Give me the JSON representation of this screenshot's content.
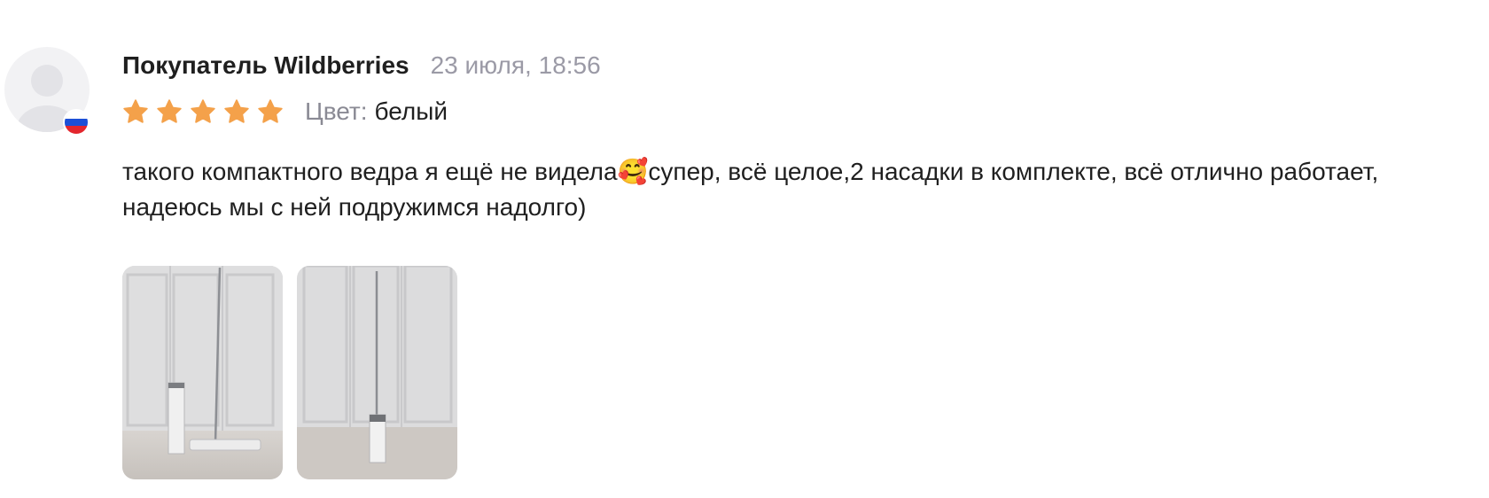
{
  "review": {
    "author": "Покупатель Wildberries",
    "date": "23 июля, 18:56",
    "rating": 5,
    "rating_max": 5,
    "star_color": "#f4a14a",
    "color_label": "Цвет:",
    "color_value": "белый",
    "text": "такого компактного ведра я ещё не видела🥰супер, всё целое,2 насадки в комплекте, всё отлично работает, надеюсь мы с ней подружимся надолго)",
    "avatar_icon": "user-placeholder-icon",
    "country_flag": "russia-flag-icon",
    "photo_count": 2
  }
}
